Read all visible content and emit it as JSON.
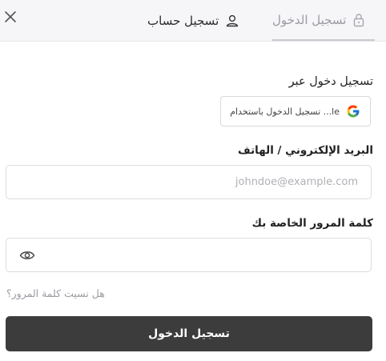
{
  "header": {
    "tabs": {
      "login_label": "تسجيل الدخول",
      "register_label": "تسجيل حساب"
    }
  },
  "login": {
    "via_label": "تسجيل دخول عبر",
    "google_button_label": "تسجيل الدخول باستخدام ...le",
    "email_label": "البريد الإلكتروني / الهاتف",
    "email_placeholder": "johndoe@example.com",
    "email_value": "",
    "password_label": "كلمة المرور الخاصة بك",
    "password_value": "",
    "forgot_password": "هل نسيت كلمة المرور؟",
    "submit_label": "تسجيل الدخول"
  },
  "icons": {
    "close": "close-icon",
    "register_tab": "user-icon",
    "login_tab": "lock-icon",
    "google": "google-icon",
    "password_toggle": "eye-icon"
  },
  "colors": {
    "header_bg": "#f6f6f8",
    "submit_bg": "#3c3c3d",
    "muted_text": "#9a9aa2"
  }
}
